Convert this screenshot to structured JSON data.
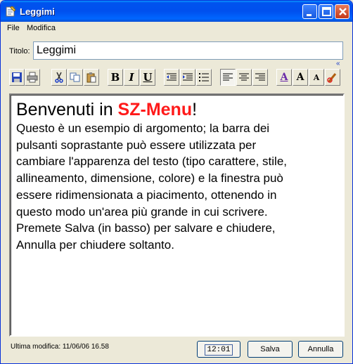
{
  "window": {
    "title": "Leggimi"
  },
  "menu": {
    "items": [
      "File",
      "Modifica"
    ]
  },
  "form": {
    "title_label": "Titolo:",
    "title_value": "Leggimi"
  },
  "toolbar": {
    "bold": "B",
    "italic": "I",
    "underline": "U",
    "font_color": "A",
    "bigger": "A",
    "smaller": "A",
    "collapse": "«"
  },
  "editor": {
    "heading_prefix": "Benvenuti in ",
    "heading_brand": "SZ-Menu",
    "heading_suffix": "!",
    "brand_color": "#ff1a1a",
    "body_lines": [
      "Questo è un esempio di argomento; la barra dei",
      "pulsanti soprastante può essere utilizzata per",
      "cambiare l'apparenza del testo (tipo carattere, stile,",
      "allineamento, dimensione, colore) e la finestra può",
      "essere ridimensionata a piacimento, ottenendo in",
      "questo modo un'area più grande in cui scrivere.",
      "Premete Salva (in basso) per salvare e chiudere,",
      "Annulla per chiudere soltanto."
    ]
  },
  "footer": {
    "last_modified": "Ultima modifica: 11/06/06 16.58",
    "time_button": "12:01",
    "save_button": "Salva",
    "cancel_button": "Annulla"
  }
}
